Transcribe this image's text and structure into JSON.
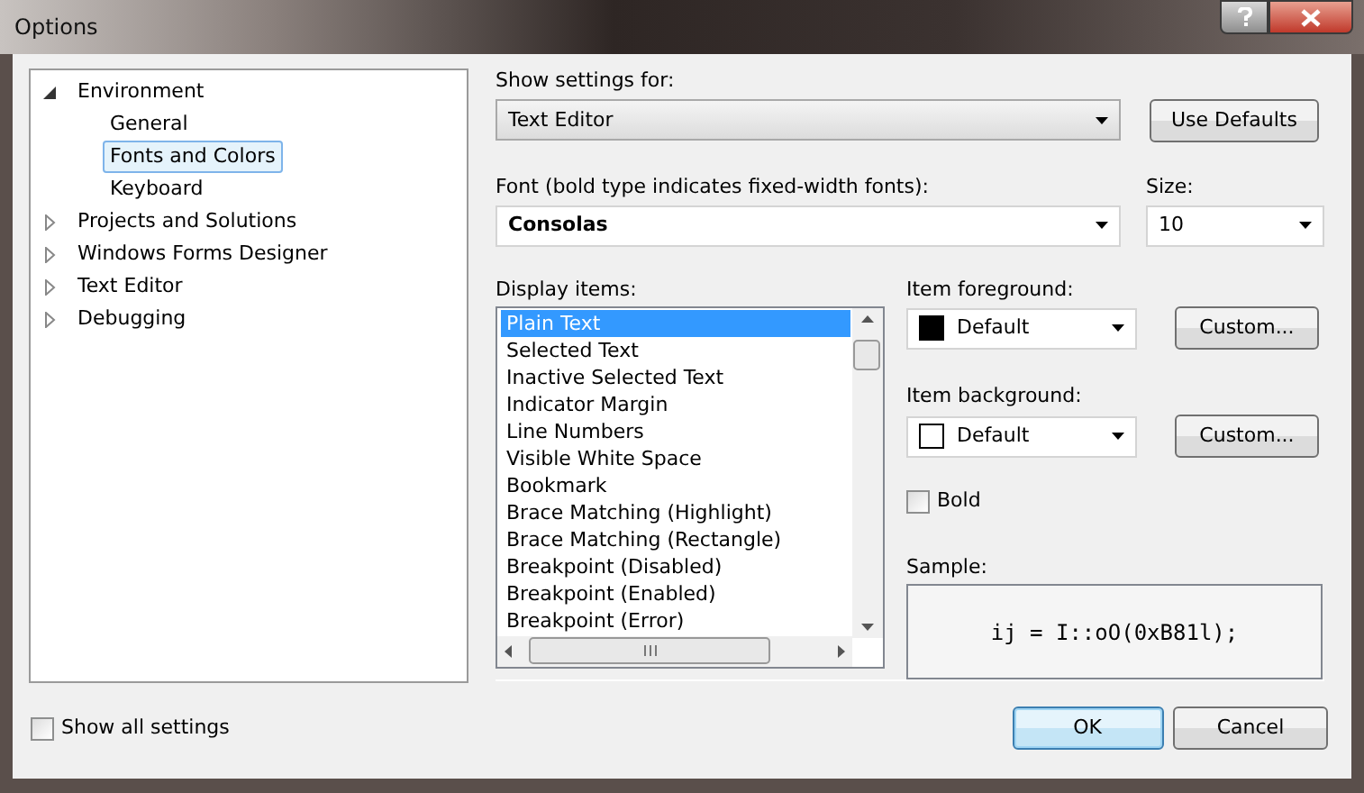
{
  "window": {
    "title": "Options"
  },
  "tree": [
    {
      "label": "Environment",
      "expanded": true,
      "selected": false,
      "children": [
        {
          "label": "General",
          "selected": false
        },
        {
          "label": "Fonts and Colors",
          "selected": true
        },
        {
          "label": "Keyboard",
          "selected": false
        }
      ]
    },
    {
      "label": "Projects and Solutions",
      "expanded": false,
      "selected": false
    },
    {
      "label": "Windows Forms Designer",
      "expanded": false,
      "selected": false
    },
    {
      "label": "Text Editor",
      "expanded": false,
      "selected": false
    },
    {
      "label": "Debugging",
      "expanded": false,
      "selected": false
    }
  ],
  "show_settings_for": {
    "label": "Show settings for:",
    "value": "Text Editor"
  },
  "use_defaults_button": "Use Defaults",
  "font": {
    "label": "Font (bold type indicates fixed-width fonts):",
    "value": "Consolas"
  },
  "size": {
    "label": "Size:",
    "value": "10"
  },
  "display_items": {
    "label": "Display items:",
    "items": [
      {
        "label": "Plain Text",
        "selected": true
      },
      {
        "label": "Selected Text",
        "selected": false
      },
      {
        "label": "Inactive Selected Text",
        "selected": false
      },
      {
        "label": "Indicator Margin",
        "selected": false
      },
      {
        "label": "Line Numbers",
        "selected": false
      },
      {
        "label": "Visible White Space",
        "selected": false
      },
      {
        "label": "Bookmark",
        "selected": false
      },
      {
        "label": "Brace Matching (Highlight)",
        "selected": false
      },
      {
        "label": "Brace Matching (Rectangle)",
        "selected": false
      },
      {
        "label": "Breakpoint (Disabled)",
        "selected": false
      },
      {
        "label": "Breakpoint (Enabled)",
        "selected": false
      },
      {
        "label": "Breakpoint (Error)",
        "selected": false
      }
    ]
  },
  "item_foreground": {
    "label": "Item foreground:",
    "value": "Default",
    "color": "#000000",
    "button": "Custom..."
  },
  "item_background": {
    "label": "Item background:",
    "value": "Default",
    "color": "#ffffff",
    "button": "Custom..."
  },
  "bold": {
    "label": "Bold",
    "checked": false
  },
  "sample": {
    "label": "Sample:",
    "text": "ij = I::oO(0xB81l);"
  },
  "show_all_settings": {
    "label": "Show all settings",
    "checked": false
  },
  "buttons": [
    {
      "label": "OK",
      "default": true
    },
    {
      "label": "Cancel",
      "default": false
    }
  ]
}
